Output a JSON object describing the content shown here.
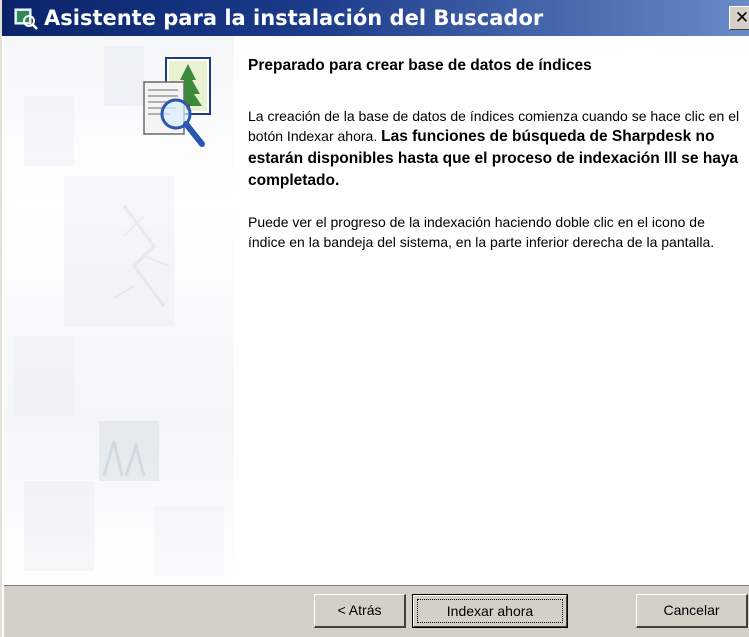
{
  "window": {
    "title": "Asistente para la instalación del Buscador",
    "close_glyph": "✕"
  },
  "content": {
    "heading": "Preparado para crear base de datos de índices",
    "para1_normal": "La creación de la base de datos de índices comienza cuando se hace clic en el botón Indexar ahora. ",
    "para1_bold": "Las funciones de búsqueda de Sharpdesk no estarán disponibles hasta que el proceso de indexación lll se haya completado.",
    "para2": "Puede ver el progreso de la indexación haciendo doble clic en el icono de índice en la bandeja del sistema, en la parte inferior derecha de la pantalla."
  },
  "buttons": {
    "back_label": "< Atrás",
    "index_label": "Indexar ahora",
    "cancel_label": "Cancelar"
  },
  "icons": {
    "title_icon": "setup-wizard-icon",
    "wizard_icon": "index-search-document-icon"
  },
  "colors": {
    "titlebar_start": "#0a246a",
    "titlebar_end": "#6a8ac8",
    "button_face": "#d4d0c8"
  }
}
